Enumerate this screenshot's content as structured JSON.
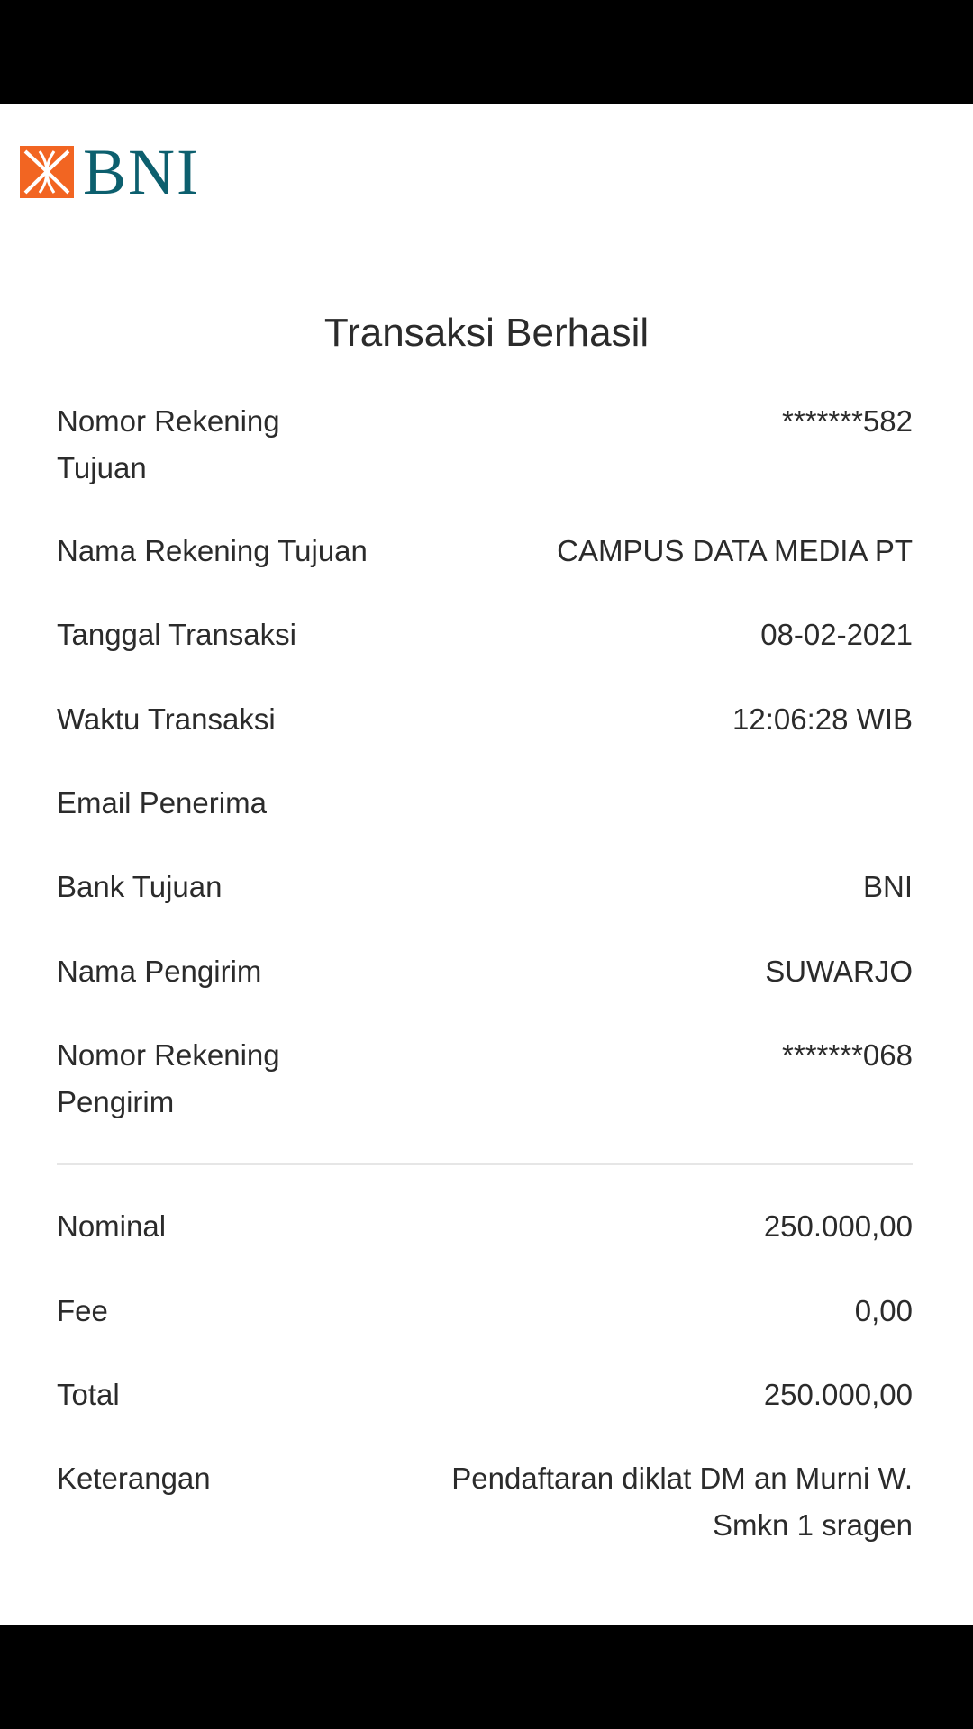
{
  "header": {
    "logo_text": "BNI",
    "logo_colors": {
      "mark": "#f26522",
      "text": "#0c5f6e"
    }
  },
  "title": "Transaksi Berhasil",
  "details": [
    {
      "label": "Nomor Rekening Tujuan",
      "value": "*******582"
    },
    {
      "label": "Nama Rekening Tujuan",
      "value": "CAMPUS DATA MEDIA PT"
    },
    {
      "label": "Tanggal Transaksi",
      "value": "08-02-2021"
    },
    {
      "label": "Waktu Transaksi",
      "value": "12:06:28 WIB"
    },
    {
      "label": "Email Penerima",
      "value": ""
    },
    {
      "label": "Bank Tujuan",
      "value": "BNI"
    },
    {
      "label": "Nama Pengirim",
      "value": "SUWARJO"
    },
    {
      "label": "Nomor Rekening Pengirim",
      "value": "*******068"
    }
  ],
  "amounts": [
    {
      "label": "Nominal",
      "value": "250.000,00"
    },
    {
      "label": "Fee",
      "value": "0,00"
    },
    {
      "label": "Total",
      "value": "250.000,00"
    },
    {
      "label": "Keterangan",
      "value": "Pendaftaran diklat DM an Murni W. Smkn 1 sragen"
    }
  ]
}
